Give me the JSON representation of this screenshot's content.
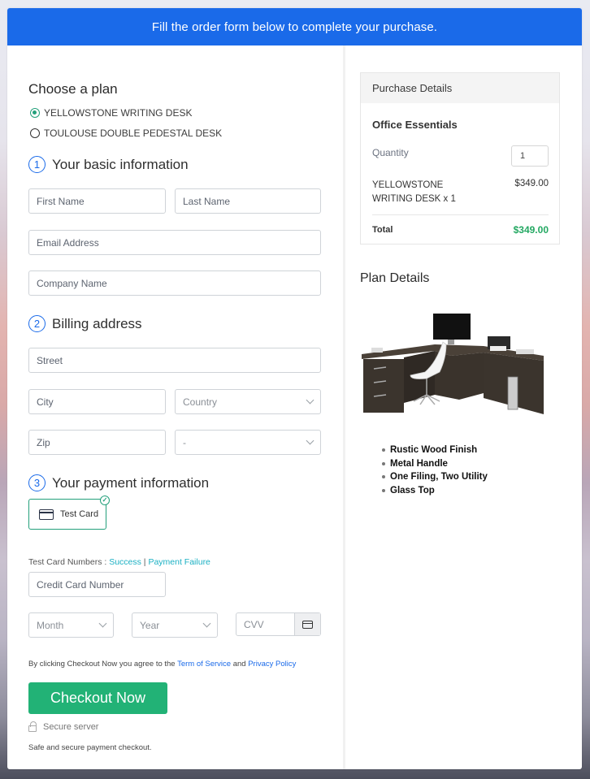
{
  "banner": {
    "text": "Fill the order form below to complete your purchase."
  },
  "plan": {
    "heading": "Choose a plan",
    "options": [
      {
        "label": "YELLOWSTONE WRITING DESK",
        "selected": true
      },
      {
        "label": "TOULOUSE DOUBLE PEDESTAL DESK",
        "selected": false
      }
    ]
  },
  "basic_info": {
    "step": "1",
    "heading": "Your basic information",
    "first_name_placeholder": "First Name",
    "last_name_placeholder": "Last Name",
    "email_placeholder": "Email Address",
    "company_placeholder": "Company Name"
  },
  "billing": {
    "step": "2",
    "heading": "Billing address",
    "street_placeholder": "Street",
    "city_placeholder": "City",
    "country_selected": "Country",
    "zip_placeholder": "Zip",
    "state_selected": "-"
  },
  "payment": {
    "step": "3",
    "heading": "Your payment information",
    "method_label": "Test Card",
    "test_numbers_label": "Test Card Numbers : ",
    "success_link": "Success",
    "separator": " | ",
    "failure_link": "Payment Failure",
    "card_number_placeholder": "Credit Card Number",
    "month_selected": "Month",
    "year_selected": "Year",
    "cvv_placeholder": "CVV"
  },
  "checkout": {
    "terms_prefix": "By clicking Checkout Now you agree to the ",
    "terms_link": "Term of Service",
    "terms_and": " and ",
    "privacy_link": "Privacy Policy",
    "button_label": "Checkout Now",
    "secure_label": "Secure server",
    "safe_text": "Safe and secure payment checkout."
  },
  "purchase_details": {
    "header": "Purchase Details",
    "title": "Office Essentials",
    "quantity_label": "Quantity",
    "quantity_value": "1",
    "item_name": "YELLOWSTONE WRITING DESK x 1",
    "item_price": "$349.00",
    "total_label": "Total",
    "total_value": "$349.00"
  },
  "plan_details": {
    "title": "Plan Details",
    "features": [
      "Rustic Wood Finish",
      "Metal Handle",
      "One Filing, Two Utility",
      "Glass Top"
    ]
  },
  "colors": {
    "primary": "#1a6ae9",
    "success": "#22b276",
    "total": "#23a862",
    "link": "#1ab0c3"
  }
}
